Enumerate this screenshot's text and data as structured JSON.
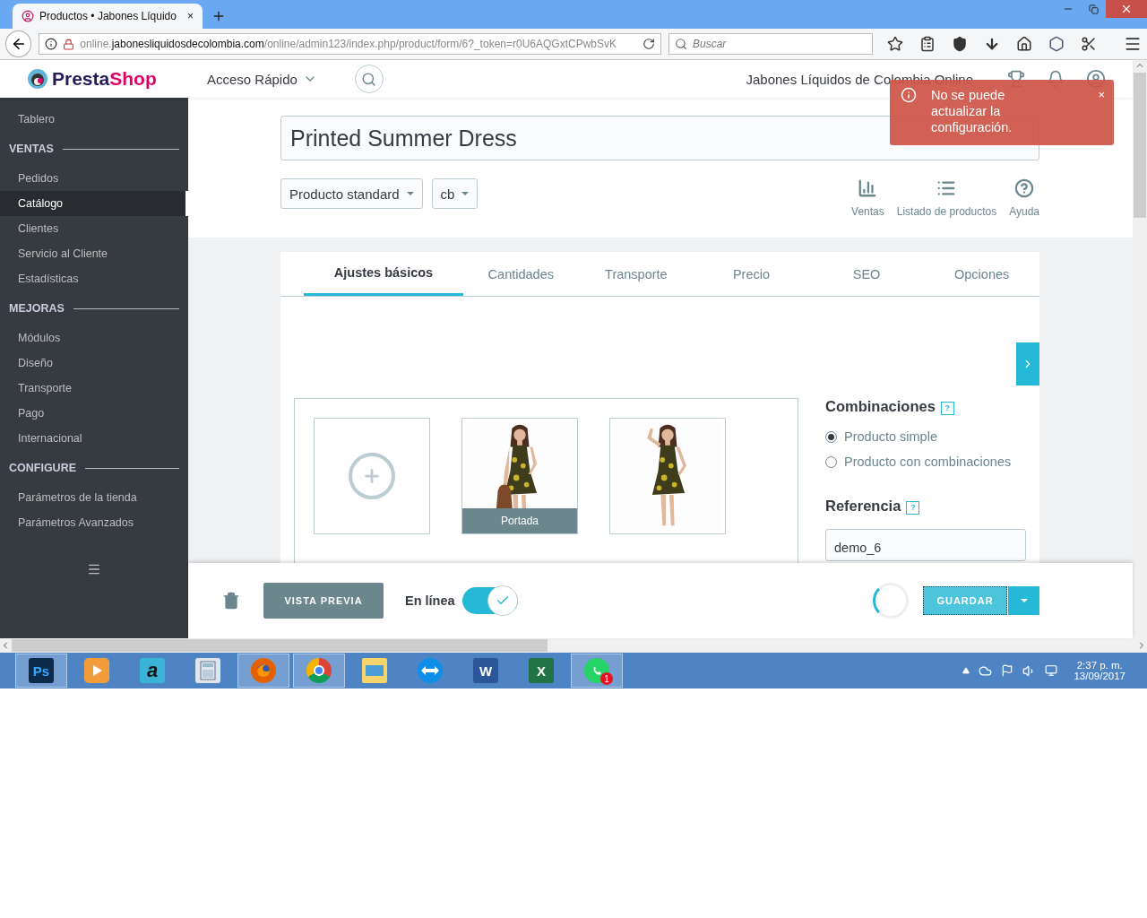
{
  "browser": {
    "tab_title": "Productos • Jabones Líquido",
    "tab_close": "×",
    "url": {
      "subdomain": "online.",
      "domain": "jabonesliquidosdecolombia.com",
      "path": "/online/admin123/index.php/product/form/6?_token=r0U6AQGxtCPwbSvK"
    },
    "search": {
      "placeholder": "Buscar"
    }
  },
  "header": {
    "logo": [
      "Presta",
      "Shop"
    ],
    "quick_access": "Acceso Rápido",
    "shop_name": "Jabones Líquidos de Colombia Online"
  },
  "toast": {
    "message": "No se puede actualizar la configuración.",
    "close": "×"
  },
  "sidebar": [
    {
      "kind": "item",
      "label": "Tablero",
      "selected": false
    },
    {
      "kind": "section",
      "label": "VENTAS"
    },
    {
      "kind": "item",
      "label": "Pedidos",
      "selected": false
    },
    {
      "kind": "item",
      "label": "Catálogo",
      "selected": true
    },
    {
      "kind": "item",
      "label": "Clientes",
      "selected": false
    },
    {
      "kind": "item",
      "label": "Servicio al Cliente",
      "selected": false
    },
    {
      "kind": "item",
      "label": "Estadísticas",
      "selected": false
    },
    {
      "kind": "section",
      "label": "MEJORAS"
    },
    {
      "kind": "item",
      "label": "Módulos",
      "selected": false
    },
    {
      "kind": "item",
      "label": "Diseño",
      "selected": false
    },
    {
      "kind": "item",
      "label": "Transporte",
      "selected": false
    },
    {
      "kind": "item",
      "label": "Pago",
      "selected": false
    },
    {
      "kind": "item",
      "label": "Internacional",
      "selected": false
    },
    {
      "kind": "section",
      "label": "CONFIGURE"
    },
    {
      "kind": "item",
      "label": "Parámetros de la tienda",
      "selected": false
    },
    {
      "kind": "item",
      "label": "Parámetros Avanzados",
      "selected": false
    }
  ],
  "product": {
    "name": "Printed Summer Dress",
    "type": "Producto standard",
    "lang": "cb"
  },
  "actions": [
    {
      "kind": "chart",
      "label": "Ventas"
    },
    {
      "kind": "list",
      "label": "Listado de productos"
    },
    {
      "kind": "help",
      "label": "Ayuda"
    }
  ],
  "tabs": [
    {
      "label": "Ajustes básicos",
      "selected": true
    },
    {
      "label": "Cantidades",
      "selected": false
    },
    {
      "label": "Transporte",
      "selected": false
    },
    {
      "label": "Precio",
      "selected": false
    },
    {
      "label": "SEO",
      "selected": false
    },
    {
      "label": "Opciones",
      "selected": false
    }
  ],
  "images": [
    {
      "kind": "add"
    },
    {
      "kind": "picture",
      "caption": "Portada"
    },
    {
      "kind": "picture"
    }
  ],
  "combinations": {
    "title": "Combinaciones",
    "help": "?",
    "options": [
      {
        "label": "Producto simple",
        "selected": true
      },
      {
        "label": "Producto con combinaciones",
        "selected": false
      }
    ]
  },
  "reference": {
    "title": "Referencia",
    "help": "?",
    "value": "demo_6"
  },
  "footer": {
    "preview": "VISTA PREVIA",
    "online_label": "En línea",
    "online": true,
    "save": "GUARDAR"
  },
  "taskbar": {
    "apps": [
      {
        "kind": "photoshop",
        "label": "Ps",
        "running": true
      },
      {
        "kind": "player",
        "running": false
      },
      {
        "kind": "script",
        "label": "a",
        "running": false
      },
      {
        "kind": "calculator",
        "running": false
      },
      {
        "kind": "firefox",
        "running": true
      },
      {
        "kind": "chrome",
        "running": true
      },
      {
        "kind": "folder",
        "running": false
      },
      {
        "kind": "remote",
        "running": false
      },
      {
        "kind": "word",
        "label": "W",
        "running": false
      },
      {
        "kind": "excel",
        "label": "X",
        "running": false
      },
      {
        "kind": "whatsapp",
        "badge": "1",
        "running": true
      }
    ],
    "clock": {
      "time": "2:37 p. m.",
      "date": "13/09/2017"
    }
  }
}
